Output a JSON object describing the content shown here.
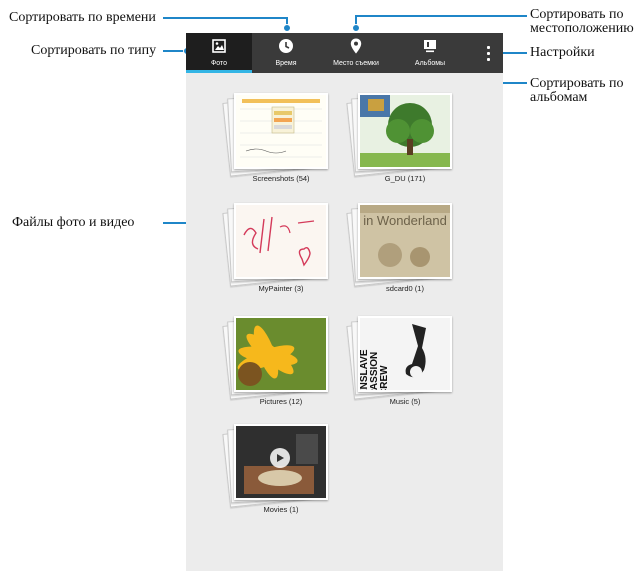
{
  "callouts": {
    "sort_time": "Сортировать по времени",
    "sort_type": "Сортировать по типу",
    "sort_location": "Сортировать по местоположению",
    "settings": "Настройки",
    "sort_albums": "Сортировать по альбомам",
    "files": "Файлы фото и видео"
  },
  "tabs": [
    {
      "label": "Фото",
      "icon": "photo-icon",
      "active": true
    },
    {
      "label": "Время",
      "icon": "clock-icon",
      "active": false
    },
    {
      "label": "Место съемки",
      "icon": "location-pin-icon",
      "active": false
    },
    {
      "label": "Альбомы",
      "icon": "album-icon",
      "active": false
    }
  ],
  "menu": {
    "icon": "overflow-menu-icon"
  },
  "albums": [
    {
      "name": "Screenshots",
      "count": "(54)",
      "label": "Screenshots (54)"
    },
    {
      "name": "G_DU",
      "count": "(171)",
      "label": "G_DU (171)"
    },
    {
      "name": "MyPainter",
      "count": "(3)",
      "label": "MyPainter (3)"
    },
    {
      "name": "sdcard0",
      "count": "(1)",
      "label": "sdcard0 (1)",
      "thumb_text": "in Wonderland"
    },
    {
      "name": "Pictures",
      "count": "(12)",
      "label": "Pictures (12)"
    },
    {
      "name": "Music",
      "count": "(5)",
      "label": "Music (5)",
      "thumb_text": "ENSLAVE PASSION CREW"
    },
    {
      "name": "Movies",
      "count": "(1)",
      "label": "Movies (1)"
    }
  ],
  "colors": {
    "accent": "#1f86c8",
    "tabbar": "#3a3a3a",
    "tab_active": "#1e1e1e",
    "tab_indicator": "#33b5e5",
    "screen_bg": "#ececec"
  }
}
